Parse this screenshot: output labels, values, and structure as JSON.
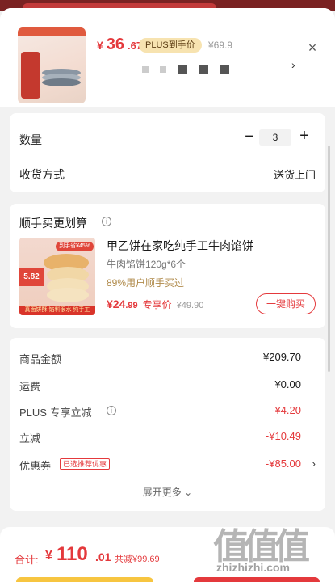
{
  "product": {
    "price_symbol": "¥",
    "price_main": "36",
    "price_decimal": ".67",
    "plus_badge": "PLUS到手价",
    "original_price": "¥69.9",
    "close_glyph": "×",
    "spec_chevron": "›"
  },
  "quantity": {
    "label": "数量",
    "minus": "−",
    "value": "3",
    "plus": "+"
  },
  "shipping": {
    "label": "收货方式",
    "value": "送货上门"
  },
  "addon": {
    "title": "顺手买更划算",
    "info_glyph": "i",
    "name": "甲乙饼在家吃纯手工牛肉馅饼",
    "spec": "牛肉馅饼120g*6个",
    "bought": "89%用户顺手买过",
    "price_symbol": "¥",
    "price_main": "24",
    "price_decimal": ".99",
    "price_tag": "专享价",
    "original_price": "¥49.90",
    "buy_button": "一键购买",
    "thumb_pct": "到手省¥45%",
    "thumb_price": "5.82",
    "thumb_band": "真面饼酥 馅料很水 纯手工"
  },
  "summary": {
    "rows": [
      {
        "label": "商品金额",
        "value": "¥209.70"
      },
      {
        "label": "运费",
        "value": "¥0.00"
      },
      {
        "label": "PLUS 专享立减",
        "value": "-¥4.20"
      },
      {
        "label": "立减",
        "value": "-¥10.49"
      },
      {
        "label": "优惠券",
        "value": "-¥85.00",
        "tag": "已选推荐优惠"
      }
    ],
    "expand_more": "展开更多 ⌄",
    "chevron": "›"
  },
  "footer": {
    "total_label": "合计:",
    "total_symbol": "¥",
    "total_main": "110",
    "total_decimal": ".01",
    "discount": "共减¥99.69"
  },
  "watermark": {
    "glyphs": "值值值",
    "text": "zhizhizhi.com"
  },
  "colors": {
    "accent_red": "#e4393c",
    "plus_gold": "#f7e3b0",
    "bought_gold": "#b08a4a"
  },
  "icons": [
    "close-icon",
    "info-icon",
    "chevron-right-icon",
    "chevron-down-icon"
  ]
}
